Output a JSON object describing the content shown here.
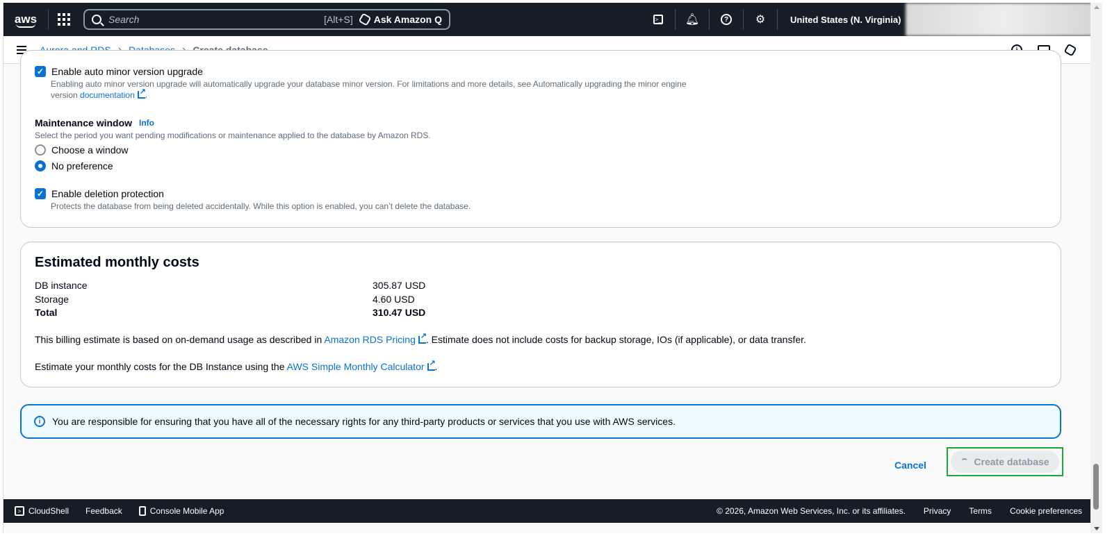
{
  "topnav": {
    "logo": "aws",
    "search_placeholder": "Search",
    "search_shortcut": "[Alt+S]",
    "ask_q": "Ask Amazon Q",
    "region": "United States (N. Virginia)",
    "icons": [
      "cloudshell-icon",
      "bell-icon",
      "help-icon",
      "gear-icon"
    ]
  },
  "breadcrumb": {
    "items": [
      "Aurora and RDS",
      "Databases"
    ],
    "current": "Create database"
  },
  "maintenance": {
    "auto_minor_label": "Enable auto minor version upgrade",
    "auto_minor_desc": "Enabling auto minor version upgrade will automatically upgrade your database minor version. For limitations and more details, see Automatically upgrading the minor engine",
    "auto_minor_desc2": "version",
    "auto_minor_link": "documentation",
    "auto_minor_tail": ".",
    "window_title": "Maintenance window",
    "window_info": "Info",
    "window_desc": "Select the period you want pending modifications or maintenance applied to the database by Amazon RDS.",
    "option_choose": "Choose a window",
    "option_none": "No preference",
    "selected": "No preference",
    "deletion_label": "Enable deletion protection",
    "deletion_desc": "Protects the database from being deleted accidentally. While this option is enabled, you can’t delete the database."
  },
  "costs": {
    "title": "Estimated monthly costs",
    "rows": [
      {
        "label": "DB instance",
        "value": "305.87 USD"
      },
      {
        "label": "Storage",
        "value": "4.60 USD"
      },
      {
        "label": "Total",
        "value": "310.47 USD"
      }
    ],
    "billing_pre": "This billing estimate is based on on-demand usage as described in",
    "billing_link": "Amazon RDS Pricing",
    "billing_post": ". Estimate does not include costs for backup storage, IOs (if applicable), or data transfer.",
    "calc_pre": "Estimate your monthly costs for the DB Instance using the",
    "calc_link": "AWS Simple Monthly Calculator",
    "calc_post": "."
  },
  "alert": {
    "text": "You are responsible for ensuring that you have all of the necessary rights for any third-party products or services that you use with AWS services."
  },
  "actions": {
    "cancel": "Cancel",
    "create": "Create database"
  },
  "footer": {
    "cloudshell": "CloudShell",
    "feedback": "Feedback",
    "mobile": "Console Mobile App",
    "copyright": "© 2026, Amazon Web Services, Inc. or its affiliates.",
    "privacy": "Privacy",
    "terms": "Terms",
    "cookies": "Cookie preferences"
  },
  "colors": {
    "nav_bg": "#161d26",
    "link": "#0972d3",
    "highlight": "#1ea83a"
  }
}
